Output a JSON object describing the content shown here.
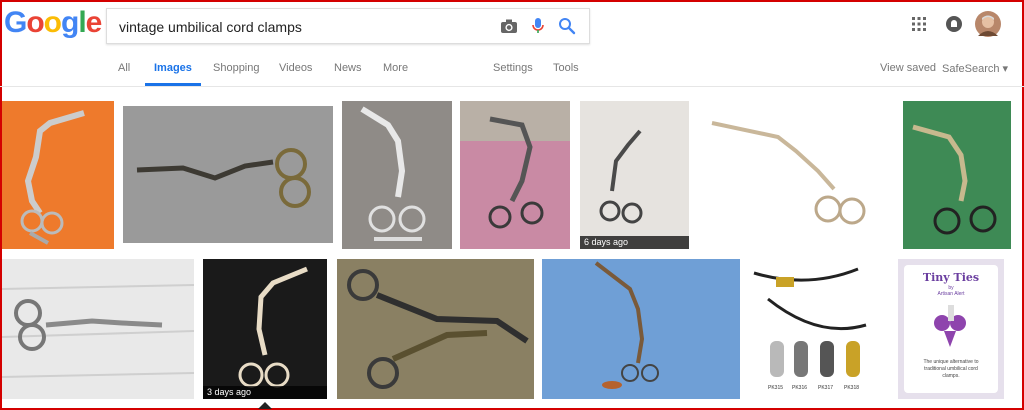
{
  "search": {
    "query": "vintage umbilical cord clamps"
  },
  "logo": {
    "letters": [
      {
        "ch": "G",
        "color": "#4285f4"
      },
      {
        "ch": "o",
        "color": "#ea4335"
      },
      {
        "ch": "o",
        "color": "#fbbc05"
      },
      {
        "ch": "g",
        "color": "#4285f4"
      },
      {
        "ch": "l",
        "color": "#34a853"
      },
      {
        "ch": "e",
        "color": "#ea4335"
      }
    ]
  },
  "nav": {
    "tabs": [
      "All",
      "Images",
      "Shopping",
      "Videos",
      "News",
      "More"
    ],
    "active": "Images",
    "tools": [
      "Settings",
      "Tools"
    ],
    "right": [
      "View saved",
      "SafeSearch ▾"
    ]
  },
  "icons": {
    "camera": "camera-icon",
    "mic": "microphone-icon",
    "search": "search-icon",
    "apps": "apps-grid-icon",
    "notifications": "notifications-icon",
    "avatar": "avatar"
  },
  "results": {
    "badges": [
      "6 days ago",
      "3 days ago"
    ],
    "card_product": {
      "line1": "Tiny Ties",
      "line2": "by",
      "line3": "Artisan Alert",
      "line4": "The unique alternative to",
      "line5": "traditional umbilical cord",
      "line6": "clamps."
    },
    "beads_labels": [
      "PK315",
      "PK316",
      "PK317",
      "PK318"
    ]
  },
  "colors": {
    "accent": "#1a73e8",
    "border": "#d40000"
  }
}
